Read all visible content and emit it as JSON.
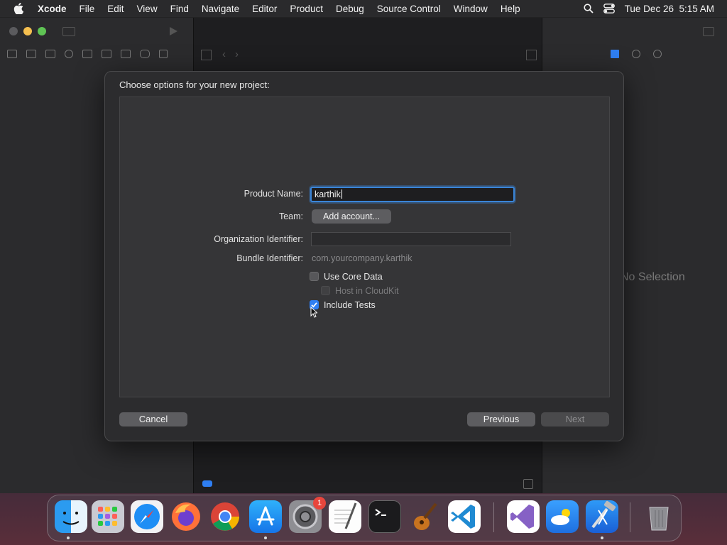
{
  "menubar": {
    "app_name": "Xcode",
    "items": [
      "File",
      "Edit",
      "View",
      "Find",
      "Navigate",
      "Editor",
      "Product",
      "Debug",
      "Source Control",
      "Window",
      "Help"
    ],
    "datetime": "Tue Dec 26  5:15 AM"
  },
  "inspector": {
    "no_selection": "No Selection"
  },
  "dialog": {
    "title": "Choose options for your new project:",
    "product_name_label": "Product Name:",
    "product_name_value": "karthik",
    "team_label": "Team:",
    "add_account_label": "Add account...",
    "org_id_label": "Organization Identifier:",
    "org_id_value": "",
    "bundle_id_label": "Bundle Identifier:",
    "bundle_id_value": "com.yourcompany.karthik",
    "use_core_data_label": "Use Core Data",
    "use_core_data_checked": false,
    "host_cloudkit_label": "Host in CloudKit",
    "host_cloudkit_checked": false,
    "include_tests_label": "Include Tests",
    "include_tests_checked": true,
    "cancel_label": "Cancel",
    "previous_label": "Previous",
    "next_label": "Next"
  },
  "dock": {
    "apps": [
      "Finder",
      "Launchpad",
      "Safari",
      "Firefox",
      "Chrome",
      "App Store",
      "System Settings",
      "TextEdit",
      "Terminal",
      "GarageBand",
      "VS Code",
      "Visual Studio",
      "Weather",
      "Xcode",
      "Trash"
    ],
    "settings_badge": "1"
  },
  "colors": {
    "accent": "#2f7ff3",
    "focus_ring": "#3a85d8",
    "badge": "#e8453c"
  }
}
